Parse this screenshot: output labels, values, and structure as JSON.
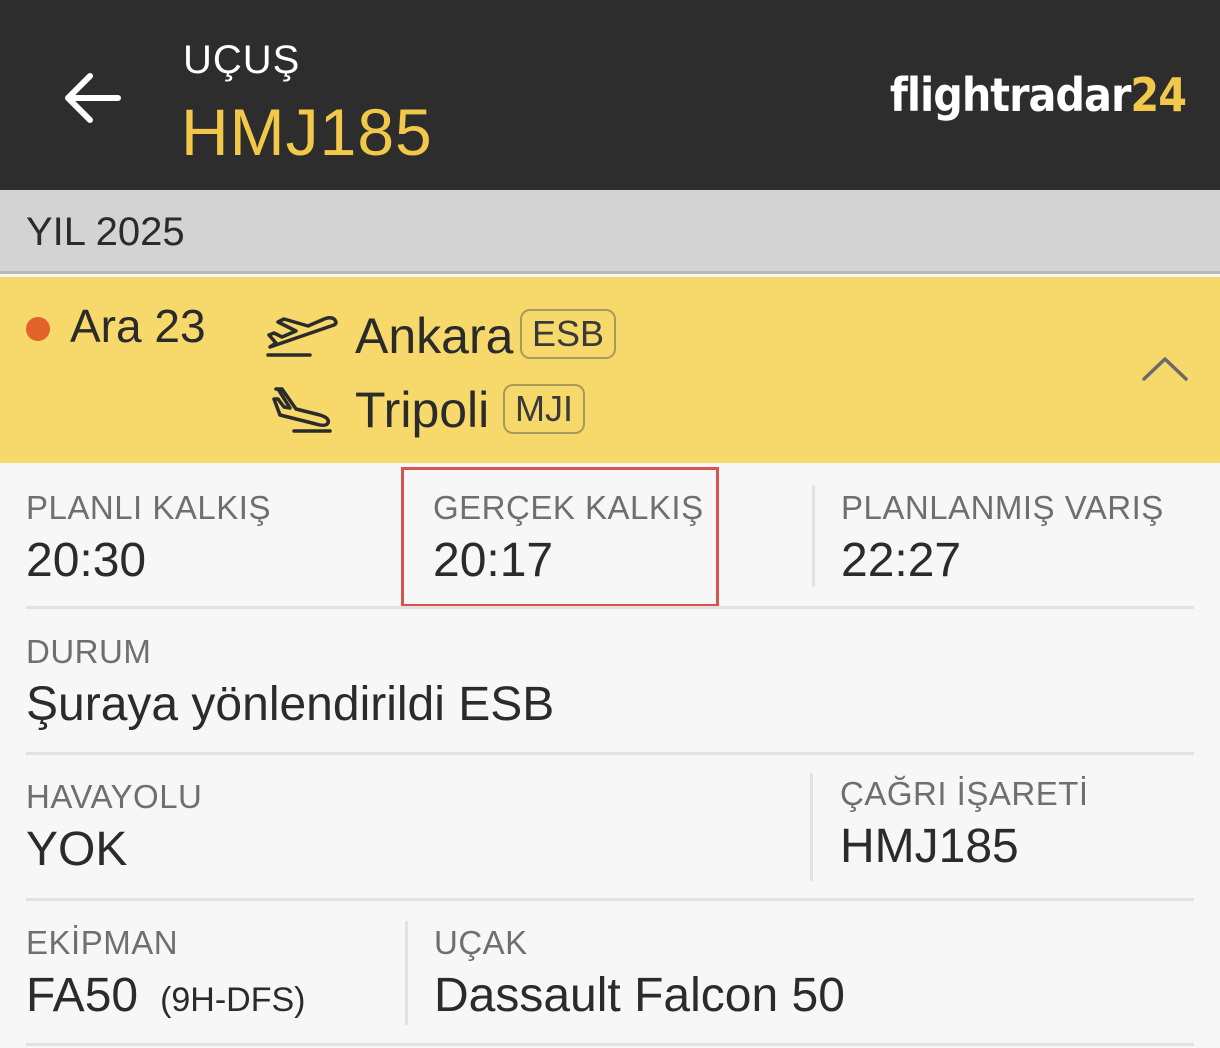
{
  "header": {
    "label": "UÇUŞ",
    "flight_number": "HMJ185",
    "brand_text": "flightradar",
    "brand_num": "24"
  },
  "year_band": {
    "label": "YIL 2025"
  },
  "flight_row": {
    "date": "Ara 23",
    "departure": {
      "city": "Ankara",
      "code": "ESB"
    },
    "arrival": {
      "city": "Tripoli",
      "code": "MJI"
    },
    "status_dot_color": "#e2622a",
    "background_color": "#f6d86b"
  },
  "details": {
    "scheduled_departure": {
      "label": "PLANLI KALKIŞ",
      "value": "20:30"
    },
    "actual_departure": {
      "label": "GERÇEK KALKIŞ",
      "value": "20:17"
    },
    "scheduled_arrival": {
      "label": "PLANLANMIŞ VARIŞ",
      "value": "22:27"
    },
    "status": {
      "label": "DURUM",
      "value": "Şuraya yönlendirildi ESB"
    },
    "airline": {
      "label": "HAVAYOLU",
      "value": "YOK"
    },
    "callsign": {
      "label": "ÇAĞRI İŞARETİ",
      "value": "HMJ185"
    },
    "equipment": {
      "label": "EKİPMAN",
      "value": "FA50",
      "registration": "(9H-DFS)"
    },
    "aircraft": {
      "label": "UÇAK",
      "value": "Dassault Falcon 50"
    }
  },
  "colors": {
    "header_bg": "#2d2d2d",
    "accent": "#f2c84b",
    "highlight_box": "#d9534f"
  },
  "icons": [
    "back-arrow-icon",
    "takeoff-plane-icon",
    "landing-plane-icon",
    "chevron-up-icon"
  ]
}
